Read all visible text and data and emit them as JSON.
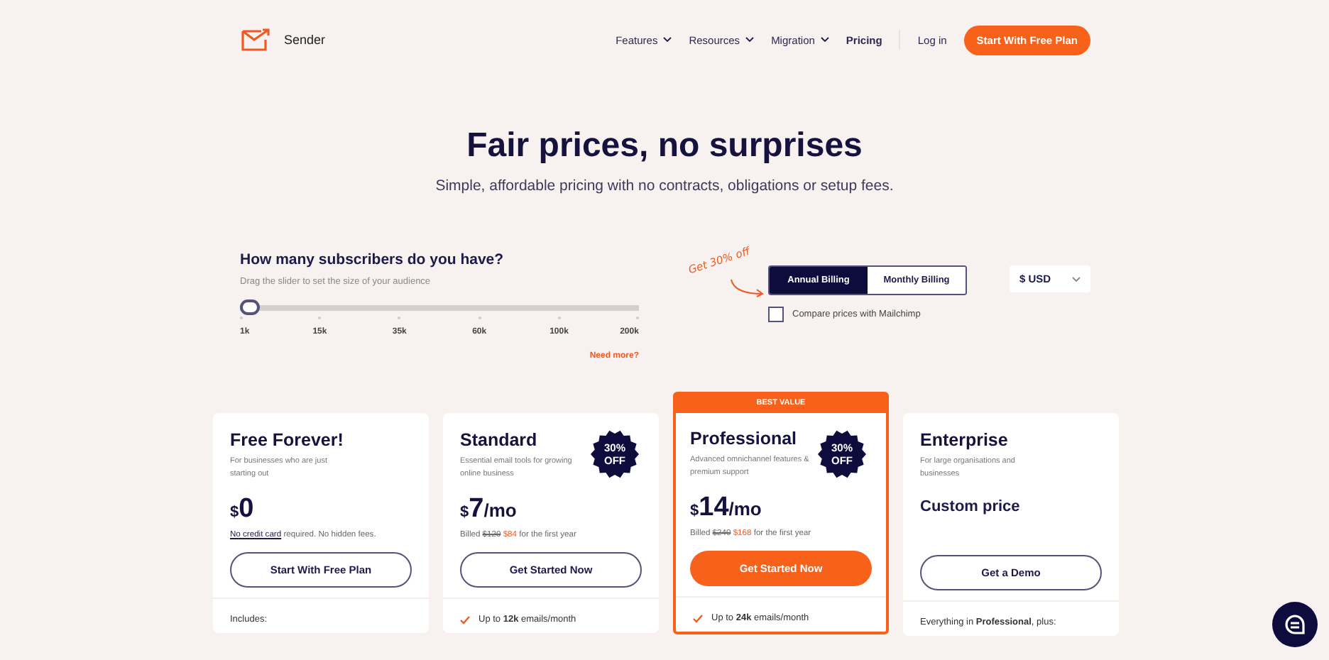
{
  "nav": {
    "brand": "Sender",
    "links": [
      {
        "label": "Features",
        "dropdown": true
      },
      {
        "label": "Resources",
        "dropdown": true
      },
      {
        "label": "Migration",
        "dropdown": true
      },
      {
        "label": "Pricing",
        "dropdown": false
      }
    ],
    "login": "Log in",
    "cta": "Start With Free Plan"
  },
  "hero": {
    "title": "Fair prices, no surprises",
    "subtitle": "Simple, affordable pricing with no contracts, obligations or setup fees."
  },
  "subscribers": {
    "question": "How many subscribers do you have?",
    "hint": "Drag the slider to set the size of your audience",
    "level": 0,
    "ticks": [
      "1k",
      "15k",
      "35k",
      "60k",
      "100k",
      "200k"
    ],
    "need_more": "Need more?"
  },
  "billing": {
    "promo": "Get 30% off",
    "tabs": [
      {
        "label": "Annual Billing",
        "selected": true
      },
      {
        "label": "Monthly Billing",
        "selected": false
      }
    ],
    "compare": {
      "label": "Compare prices with Mailchimp",
      "checked": false
    },
    "currency": "$ USD"
  },
  "plans": [
    {
      "name": "Free Forever!",
      "featured": false,
      "description": "For businesses who are just starting out",
      "price": {
        "currency": "$",
        "amount": "0"
      },
      "note": {
        "link": "No credit card",
        "text": "required. No hidden fees."
      },
      "button": {
        "label": "Start With Free Plan"
      },
      "feature": {
        "kind": "text",
        "text": "Includes:"
      }
    },
    {
      "name": "Standard",
      "featured": false,
      "discount": [
        "30%",
        "OFF"
      ],
      "description": "Essential email tools for growing online business",
      "price": {
        "currency": "$",
        "amount": "7",
        "period": "/mo"
      },
      "billed": {
        "prefix": "Billed",
        "old": "$120",
        "new": "$84",
        "suffix": "for the first year"
      },
      "button": {
        "label": "Get Started Now"
      },
      "feature": {
        "kind": "check",
        "text": "Up to **12k** emails/month"
      }
    },
    {
      "name": "Professional",
      "featured": true,
      "banner": "BEST VALUE",
      "discount": [
        "30%",
        "OFF"
      ],
      "description": "Advanced omnichannel features & premium support",
      "price": {
        "currency": "$",
        "amount": "14",
        "period": "/mo"
      },
      "billed": {
        "prefix": "Billed",
        "old": "$240",
        "new": "$168",
        "suffix": "for the first year"
      },
      "button": {
        "label": "Get Started Now"
      },
      "feature": {
        "kind": "check",
        "text": "Up to **24k** emails/month"
      }
    },
    {
      "name": "Enterprise",
      "featured": false,
      "description": "For large organisations and businesses",
      "custom_price": "Custom price",
      "button": {
        "label": "Get a Demo"
      },
      "feature": {
        "kind": "text",
        "text": "Everything in **Professional**, plus:"
      }
    }
  ]
}
